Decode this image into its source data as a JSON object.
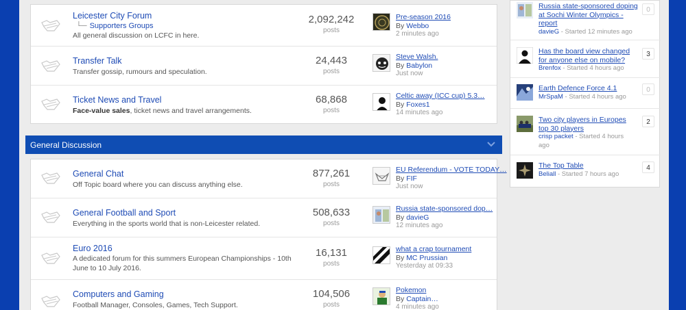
{
  "categories": [
    {
      "forums": [
        {
          "title": "Leicester City Forum",
          "subforum": "Supporters Groups",
          "description": "All general discussion on LCFC in here.",
          "posts": "2,092,242",
          "posts_label": "posts",
          "last_post": {
            "title": "Pre-season 2016",
            "by_label": "By",
            "author": "Webbo",
            "time": "2 minutes ago"
          }
        },
        {
          "title": "Transfer Talk",
          "description": "Transfer gossip, rumours and speculation.",
          "posts": "24,443",
          "posts_label": "posts",
          "last_post": {
            "title": "Steve Walsh.",
            "by_label": "By",
            "author": "Babylon",
            "time": "Just now"
          }
        },
        {
          "title": "Ticket News and Travel",
          "description_bold": "Face-value sales",
          "description": ", ticket news and travel arrangements.",
          "posts": "68,868",
          "posts_label": "posts",
          "last_post": {
            "title": "Celtic away (ICC cup) 5.3…",
            "by_label": "By",
            "author": "Foxes1",
            "time": "14 minutes ago"
          }
        }
      ]
    },
    {
      "name": "General Discussion",
      "forums": [
        {
          "title": "General Chat",
          "description": "Off Topic board where you can discuss anything else.",
          "posts": "877,261",
          "posts_label": "posts",
          "last_post": {
            "title": "EU Referendum - VOTE TODAY…",
            "by_label": "By",
            "author": "FIF",
            "time": "Just now"
          }
        },
        {
          "title": "General Football and Sport",
          "description": "Everything in the sports world that is non-Leicester related.",
          "posts": "508,633",
          "posts_label": "posts",
          "last_post": {
            "title": "Russia state-sponsored dop…",
            "by_label": "By",
            "author": "davieG",
            "time": "12 minutes ago"
          }
        },
        {
          "title": "Euro 2016",
          "description_line1": "A dedicated forum for this summers European Championships - 10th",
          "description_line2": "June to 10 July 2016.",
          "posts": "16,131",
          "posts_label": "posts",
          "last_post": {
            "title": "what a crap tournament",
            "by_label": "By",
            "author": "MC Prussian",
            "time": "Yesterday at 09:33"
          }
        },
        {
          "title": "Computers and Gaming",
          "description": "Football Manager, Consoles, Games, Tech Support.",
          "posts": "104,506",
          "posts_label": "posts",
          "last_post": {
            "title": "Pokemon",
            "by_label": "By",
            "author": "Captain…",
            "time": "4 minutes ago"
          }
        }
      ]
    }
  ],
  "sidebar": {
    "items": [
      {
        "title_line1": "Russia state-sponsored doping",
        "title_line2": "at Sochi Winter Olympics -",
        "title_line3": "report",
        "author": "davieG",
        "meta": " - Started 12 minutes ago",
        "count": "0"
      },
      {
        "title_line1": "Has the board view changed",
        "title_line2": "for anyone else on mobile?",
        "author": "Brenfox",
        "meta": " - Started 4 hours ago",
        "count": "3"
      },
      {
        "title_line1": "Earth Defence Force 4.1",
        "author": "MrSpaM",
        "meta": " - Started 4 hours ago",
        "count": "0"
      },
      {
        "title_line1": "Two city players in Europes",
        "title_line2": "top 30 players",
        "author": "crisp packet",
        "meta": " - Started 4 hours",
        "meta2": "ago",
        "count": "2"
      },
      {
        "title_line1": "The Top Table",
        "author": "Beliall",
        "meta": " - Started 7 hours ago",
        "count": "4"
      }
    ]
  },
  "colors": {
    "page_background": "#0a3fb0",
    "category_header": "#0f4db3",
    "link": "#1e4bb5"
  },
  "icons": {
    "forum_icon": "fox-outline-icon",
    "collapse_icon": "chevron-down-icon"
  }
}
